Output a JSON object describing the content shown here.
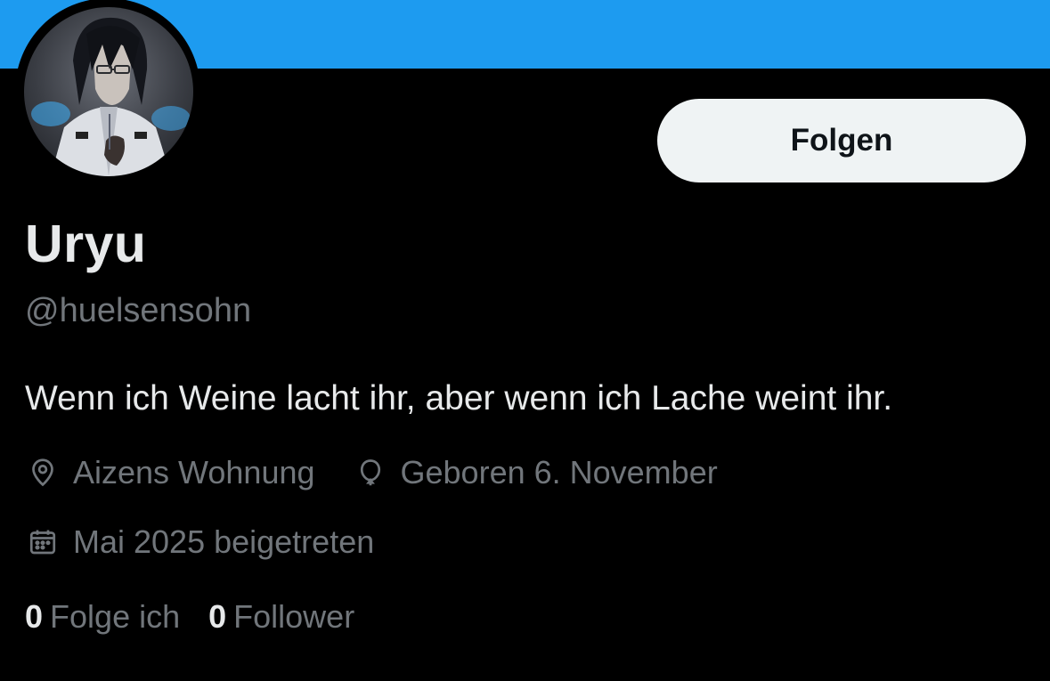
{
  "colors": {
    "banner": "#1d9bf0",
    "background": "#000000",
    "primary_text": "#e7e9ea",
    "secondary_text": "#71767b",
    "follow_button_bg": "#eff3f4",
    "follow_button_text": "#0f1419"
  },
  "profile": {
    "display_name": "Uryu",
    "handle": "@huelsensohn",
    "bio": "Wenn ich Weine lacht ihr, aber wenn ich Lache weint ihr.",
    "avatar_icon": "profile-avatar"
  },
  "actions": {
    "follow_label": "Folgen"
  },
  "meta": {
    "location": {
      "icon": "location-pin-icon",
      "text": "Aizens Wohnung"
    },
    "birthday": {
      "icon": "balloon-icon",
      "text": "Geboren 6. November"
    },
    "joined": {
      "icon": "calendar-icon",
      "text": "Mai 2025 beigetreten"
    }
  },
  "stats": {
    "following": {
      "count": "0",
      "label": "Folge ich"
    },
    "followers": {
      "count": "0",
      "label": "Follower"
    }
  }
}
